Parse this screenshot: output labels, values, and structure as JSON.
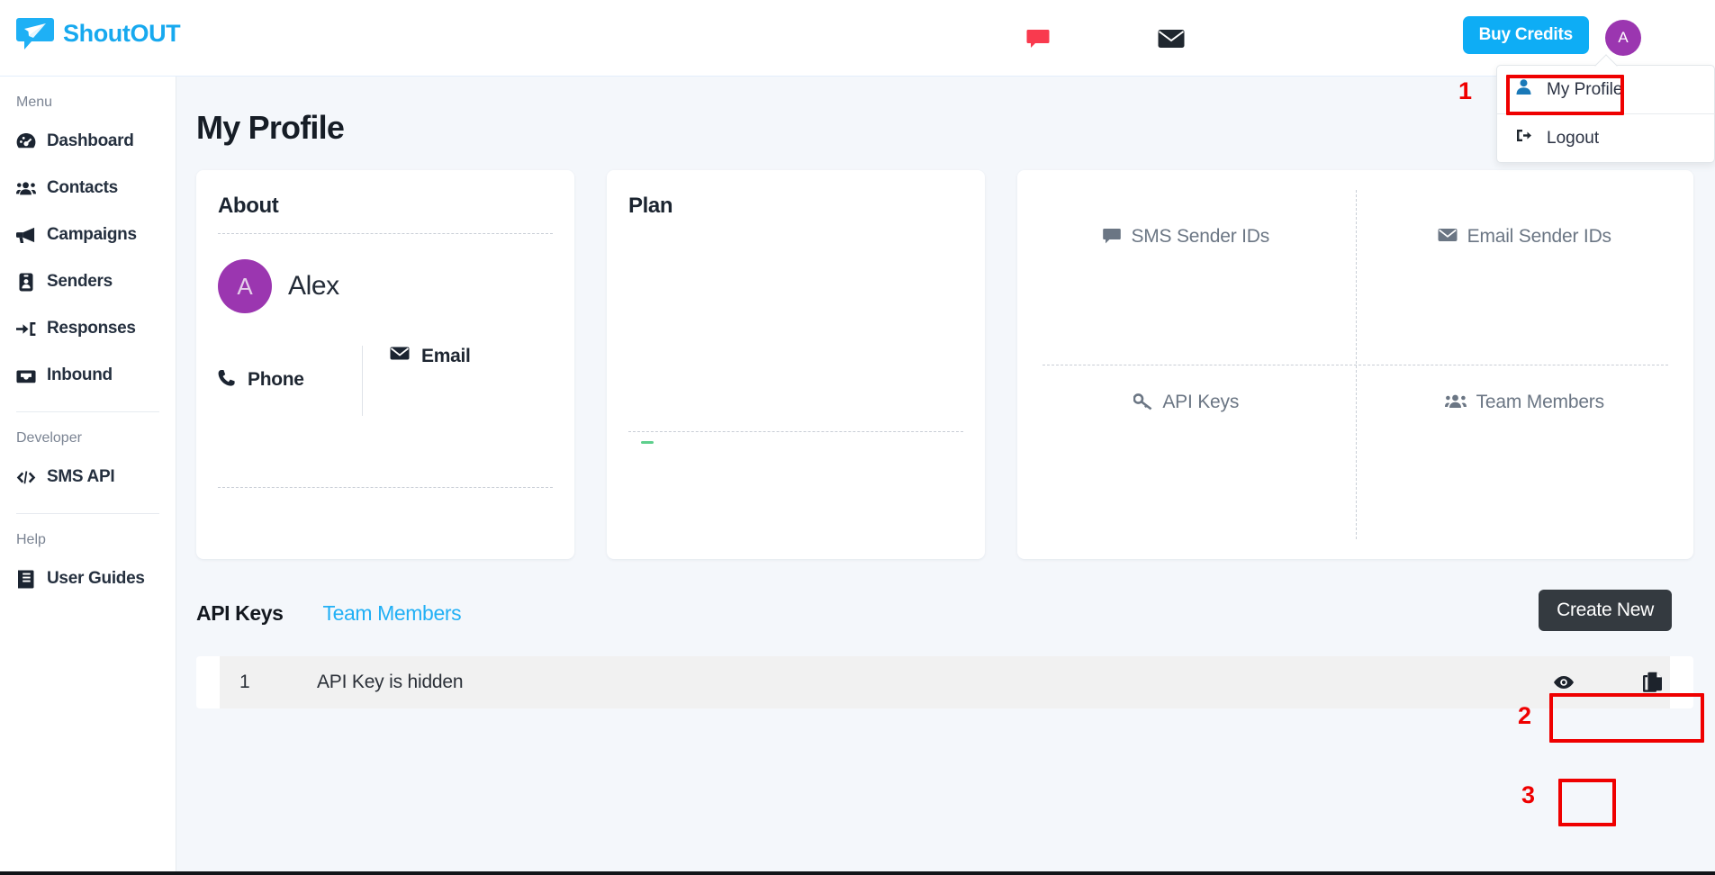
{
  "brand": {
    "name": "ShoutOUT",
    "logo_icon": "paper-plane-chat-icon",
    "color": "#17a9ef"
  },
  "topbar": {
    "chat_icon": "chat-bubble-icon",
    "chat_icon_color": "#f93a4e",
    "mail_icon": "envelope-icon",
    "buy_credits_label": "Buy Credits",
    "buy_credits_color": "#0eadf5",
    "avatar_initial": "A",
    "avatar_color": "#9b36b0"
  },
  "dropdown": {
    "items": [
      {
        "label": "My Profile",
        "icon": "user-icon",
        "icon_color": "#1a79b8"
      },
      {
        "label": "Logout",
        "icon": "sign-out-icon",
        "icon_color": "#20272f"
      }
    ]
  },
  "sidebar": {
    "menu_label": "Menu",
    "menu_items": [
      {
        "label": "Dashboard",
        "icon": "gauge-icon"
      },
      {
        "label": "Contacts",
        "icon": "users-icon"
      },
      {
        "label": "Campaigns",
        "icon": "megaphone-icon"
      },
      {
        "label": "Senders",
        "icon": "id-badge-icon"
      },
      {
        "label": "Responses",
        "icon": "sign-in-arrow-icon"
      },
      {
        "label": "Inbound",
        "icon": "inbox-icon"
      }
    ],
    "developer_label": "Developer",
    "developer_items": [
      {
        "label": "SMS API",
        "icon": "code-icon"
      }
    ],
    "help_label": "Help",
    "help_items": [
      {
        "label": "User Guides",
        "icon": "book-icon"
      }
    ]
  },
  "page": {
    "title": "My Profile"
  },
  "about": {
    "heading": "About",
    "avatar_initial": "A",
    "name": "Alex",
    "phone_label": "Phone",
    "phone_icon": "phone-icon",
    "email_label": "Email",
    "email_icon": "envelope-icon"
  },
  "plan": {
    "heading": "Plan",
    "accent_color": "#5ecf8d"
  },
  "quick_links": {
    "items": [
      {
        "label": "SMS Sender IDs",
        "icon": "comment-icon"
      },
      {
        "label": "Email Sender IDs",
        "icon": "envelope-icon"
      },
      {
        "label": "API Keys",
        "icon": "key-icon"
      },
      {
        "label": "Team Members",
        "icon": "users-icon"
      }
    ]
  },
  "api_keys": {
    "tab_active": "API Keys",
    "tab_link": "Team Members",
    "create_label": "Create New",
    "rows": [
      {
        "index": "1",
        "value": "API Key is hidden",
        "view_icon": "eye-icon",
        "copy_icon": "copy-icon"
      }
    ]
  },
  "annotations": {
    "one": "1",
    "two": "2",
    "three": "3",
    "color": "#ef0000"
  }
}
